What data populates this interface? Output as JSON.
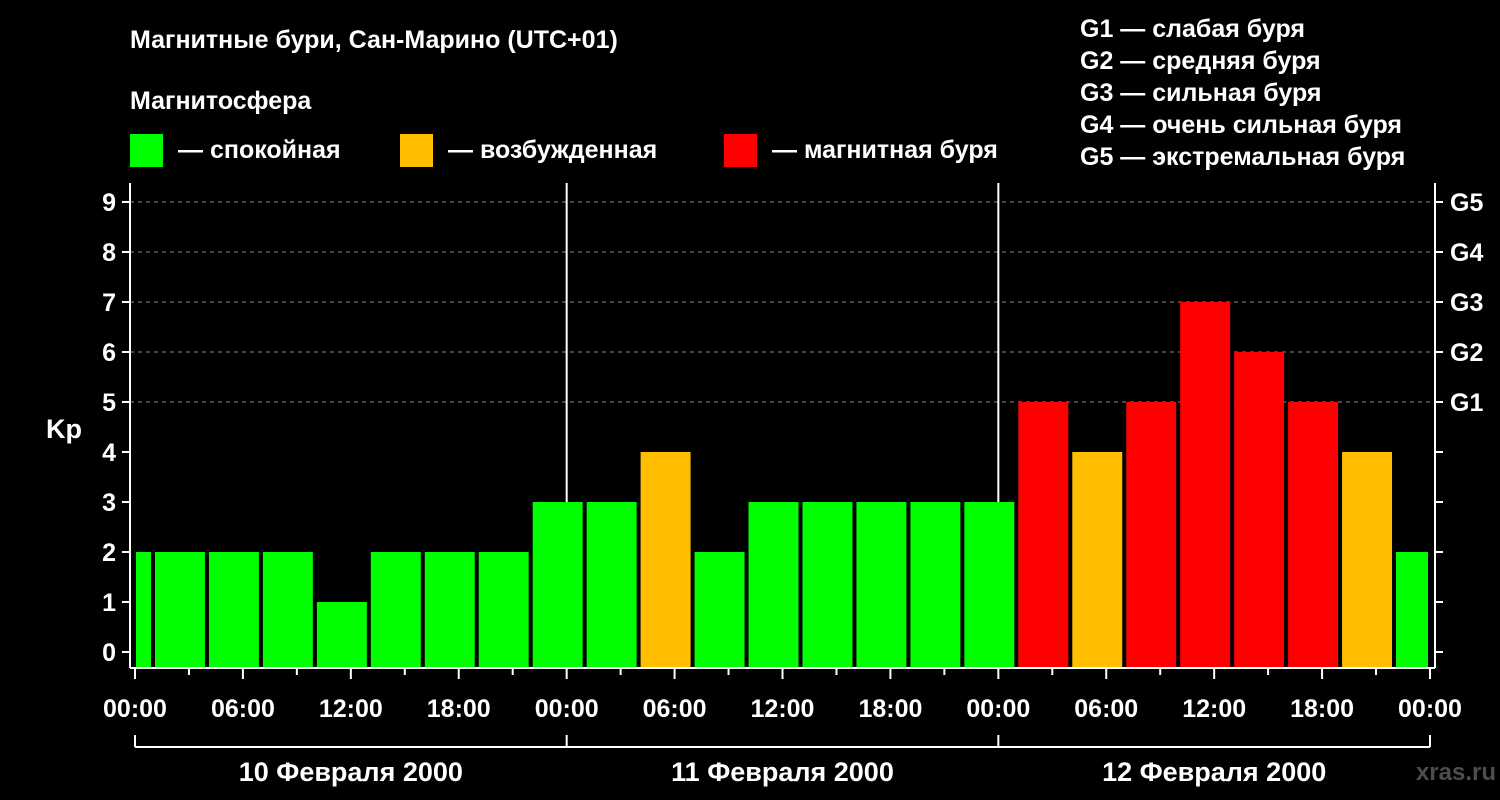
{
  "chart_data": {
    "type": "bar",
    "title": "Магнитные бури, Сан-Марино (UTC+01)",
    "legend": {
      "heading": "Магнитосфера",
      "items": [
        {
          "label": "— спокойная",
          "color": "#00ff00"
        },
        {
          "label": "— возбужденная",
          "color": "#ffbf00"
        },
        {
          "label": "— магнитная буря",
          "color": "#ff0000"
        }
      ]
    },
    "storm_scale": [
      "G1 — слабая буря",
      "G2 — средняя буря",
      "G3 — сильная буря",
      "G4 — очень сильная буря",
      "G5 — экстремальная буря"
    ],
    "ylabel": "Kp",
    "ylim": [
      0,
      9
    ],
    "yticks": [
      "0",
      "1",
      "2",
      "3",
      "4",
      "5",
      "6",
      "7",
      "8",
      "9"
    ],
    "right_ticks": [
      {
        "kp": 5,
        "label": "G1"
      },
      {
        "kp": 6,
        "label": "G2"
      },
      {
        "kp": 7,
        "label": "G3"
      },
      {
        "kp": 8,
        "label": "G4"
      },
      {
        "kp": 9,
        "label": "G5"
      }
    ],
    "xtick_labels": [
      "00:00",
      "06:00",
      "12:00",
      "18:00",
      "00:00",
      "06:00",
      "12:00",
      "18:00",
      "00:00",
      "06:00",
      "12:00",
      "18:00",
      "00:00"
    ],
    "days": [
      "10 Февраля 2000",
      "11 Февраля 2000",
      "12 Февраля 2000"
    ],
    "interval_hours": 3,
    "start_hour": 22,
    "values": [
      2,
      2,
      2,
      2,
      1,
      2,
      2,
      2,
      3,
      3,
      4,
      2,
      3,
      3,
      3,
      3,
      3,
      5,
      4,
      5,
      7,
      6,
      5,
      4,
      2
    ],
    "thresholds": {
      "quiet_max": 3,
      "active_max": 4
    },
    "colors": {
      "quiet": "#00ff00",
      "active": "#ffbf00",
      "storm": "#ff0000"
    },
    "watermark": "xras.ru"
  }
}
